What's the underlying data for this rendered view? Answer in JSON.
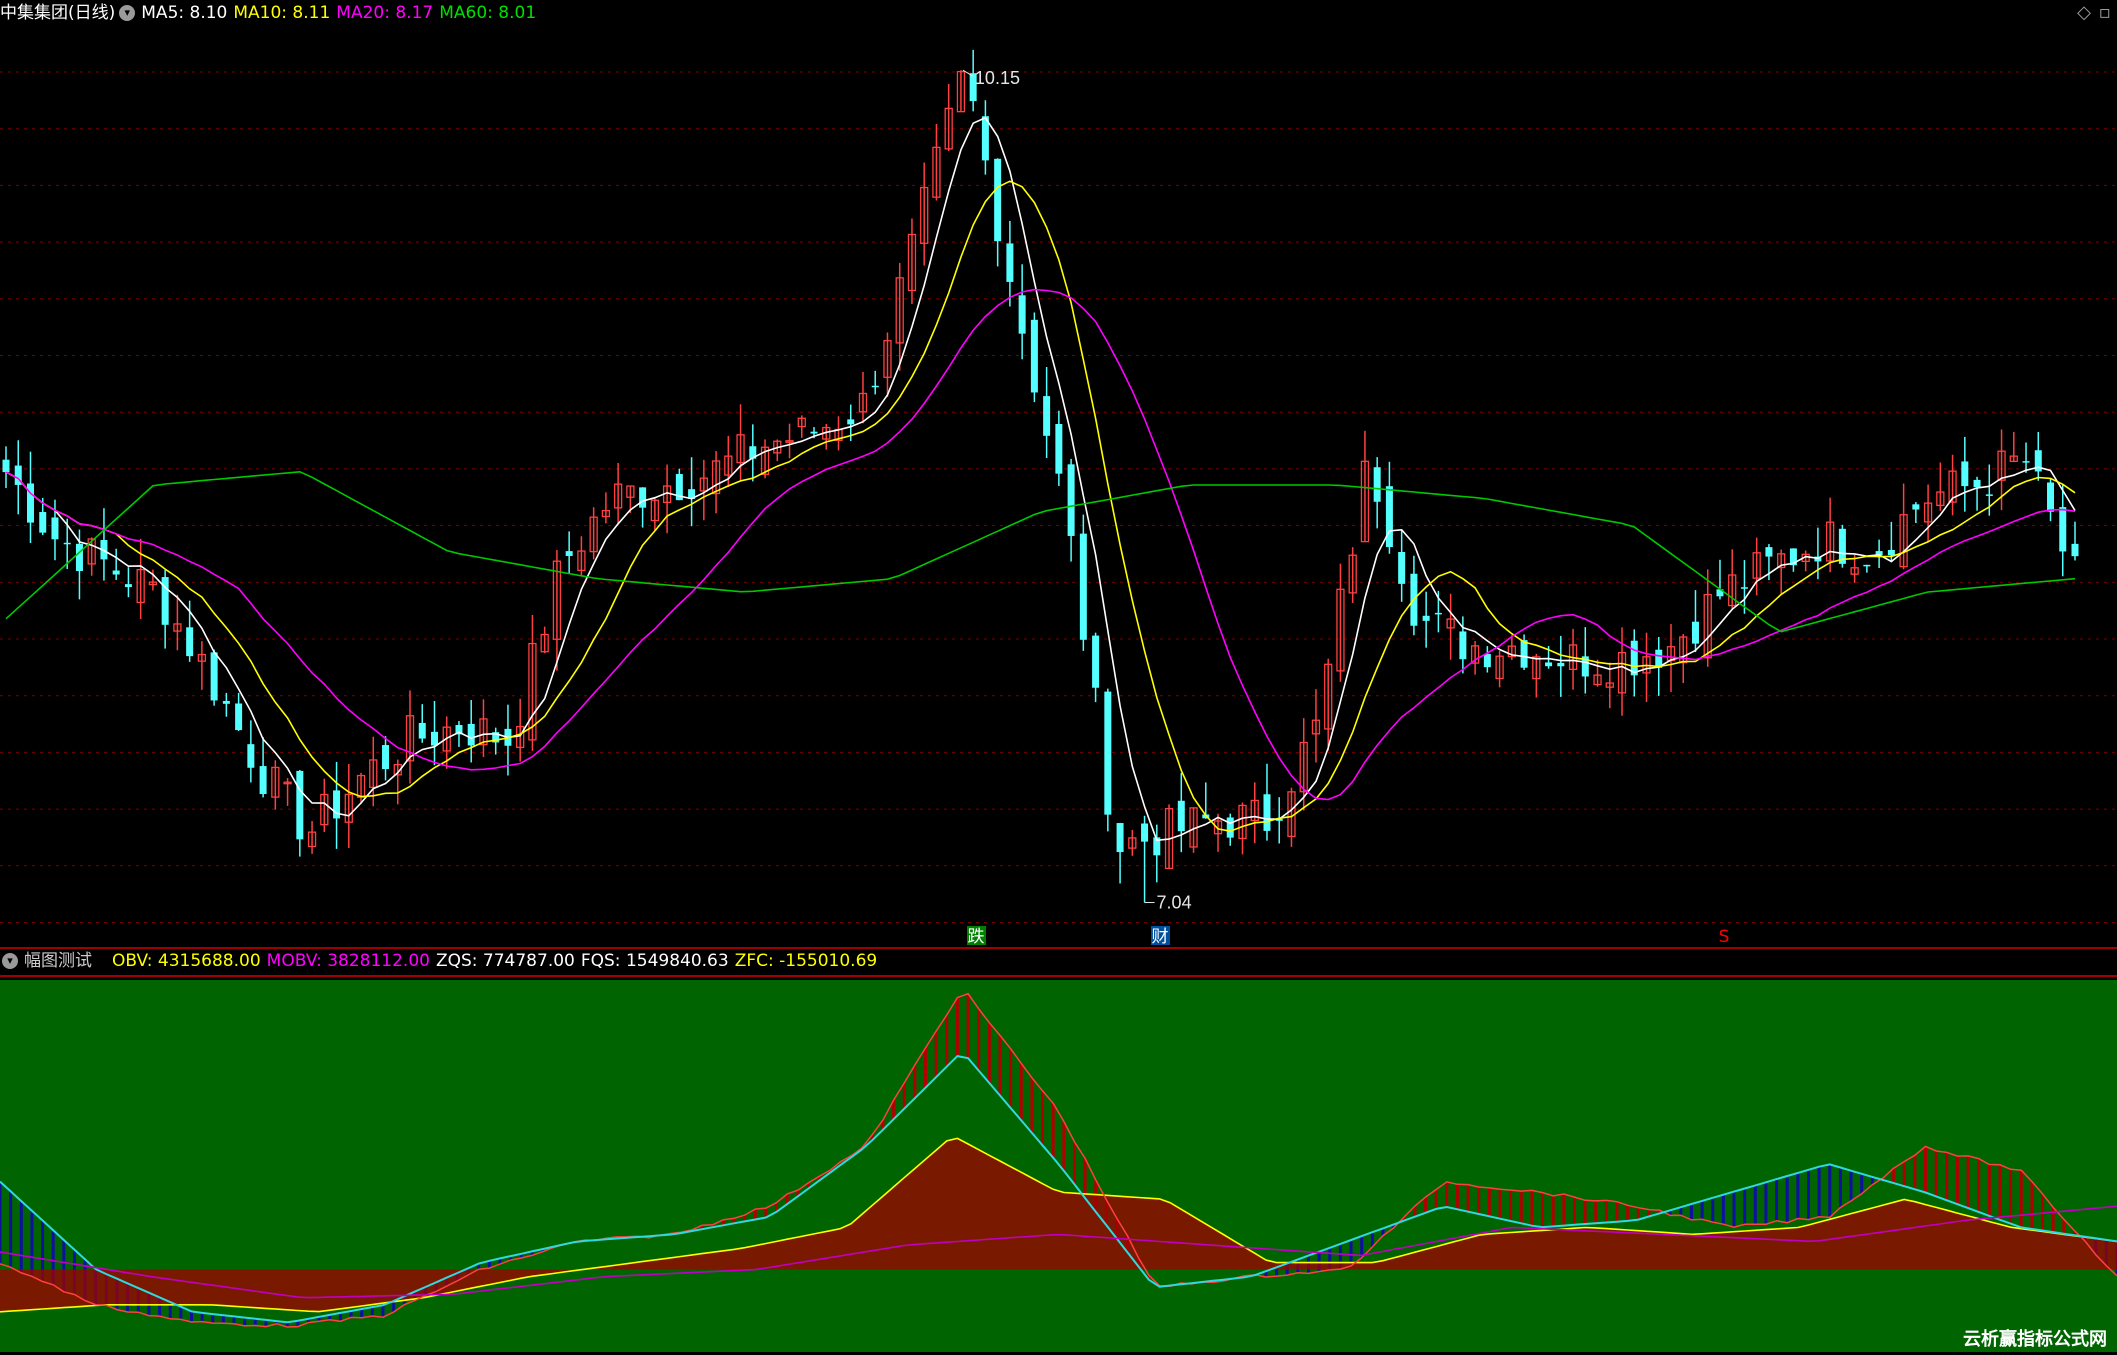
{
  "top_panel": {
    "title": "中集集团(日线)",
    "indicators": [
      {
        "label": "MA5: 8.10",
        "color": "#ffffff"
      },
      {
        "label": "MA10: 8.11",
        "color": "#ffff00"
      },
      {
        "label": "MA20: 8.17",
        "color": "#ff00ff"
      },
      {
        "label": "MA60: 8.01",
        "color": "#00e000"
      }
    ],
    "high_label": "10.15",
    "low_label": "7.04",
    "markers": [
      {
        "text": "跌",
        "color": "#ffffff",
        "bg": "#008000"
      },
      {
        "text": "财",
        "color": "#ffffff",
        "bg": "#0050a0"
      },
      {
        "text": "S",
        "color": "#ff0000",
        "bg": ""
      }
    ]
  },
  "bottom_panel": {
    "title": "幅图测试",
    "indicators": [
      {
        "label": "OBV: 4315688.00",
        "color": "#ffff00"
      },
      {
        "label": "MOBV: 3828112.00",
        "color": "#ff00ff"
      },
      {
        "label": "ZQS: 774787.00",
        "color": "#ffffff"
      },
      {
        "label": "FQS: 1549840.63",
        "color": "#ffffff"
      },
      {
        "label": "ZFC: -155010.69",
        "color": "#ffff00"
      }
    ]
  },
  "watermark": "云析赢指标公式网",
  "colors": {
    "up": "#ff4040",
    "down": "#54ffff",
    "grid": "#7a0000",
    "panel_bg": "#006400",
    "ma5": "#ffffff",
    "ma10": "#ffff00",
    "ma20": "#ff00ff",
    "ma60": "#00c800"
  },
  "chart_data": [
    {
      "type": "candlestick",
      "title": "中集集团(日线)",
      "ylim": [
        6.9,
        10.3
      ],
      "price_keypoints": [
        8.65,
        8.4,
        8.3,
        8.2,
        7.9,
        7.55,
        7.3,
        7.5,
        7.65,
        7.7,
        7.65,
        8.3,
        8.55,
        8.6,
        8.65,
        8.75,
        8.8,
        8.9,
        9.5,
        10.15,
        9.3,
        8.5,
        7.25,
        7.3,
        7.35,
        7.35,
        7.7,
        8.7,
        8.1,
        8.0,
        8.0,
        7.95,
        7.95,
        8.0,
        8.2,
        8.3,
        8.4,
        8.35,
        8.55,
        8.6,
        8.7,
        8.25
      ],
      "ma60_keypoints": [
        8.1,
        8.6,
        8.65,
        8.35,
        8.25,
        8.2,
        8.25,
        8.5,
        8.6,
        8.6,
        8.55,
        8.45,
        8.05,
        8.2,
        8.25
      ],
      "high": 10.15,
      "low": 7.04
    },
    {
      "type": "area",
      "title": "幅图测试",
      "series": [
        {
          "name": "OBV",
          "values": [
            4315688.0
          ]
        },
        {
          "name": "MOBV",
          "values": [
            3828112.0
          ]
        },
        {
          "name": "ZQS",
          "values": [
            774787.0
          ]
        },
        {
          "name": "FQS",
          "values": [
            1549840.63
          ]
        },
        {
          "name": "ZFC",
          "values": [
            -155010.69
          ]
        }
      ]
    }
  ]
}
